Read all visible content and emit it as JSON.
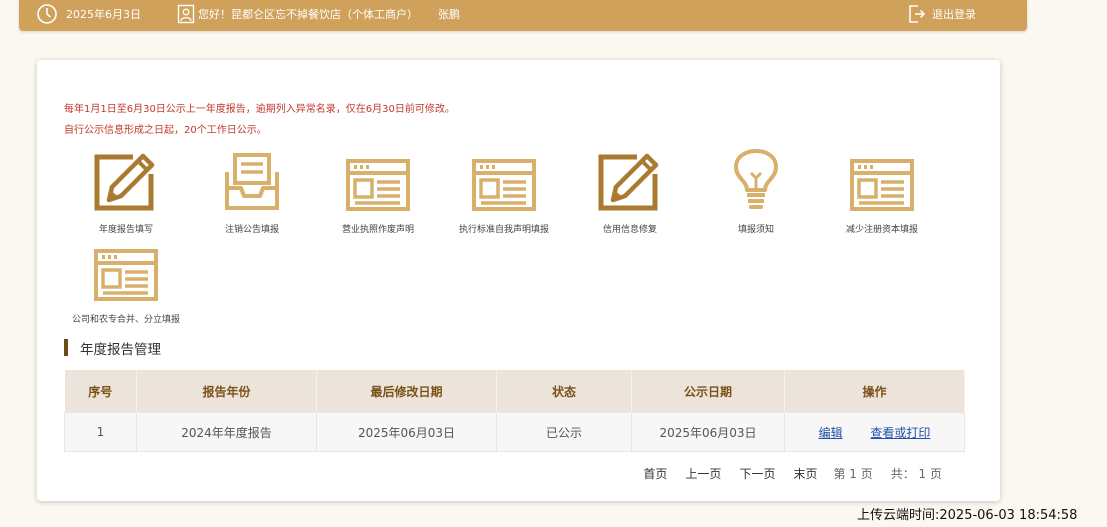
{
  "header": {
    "date": "2025年6月3日",
    "greeting": "您好！昆都仑区忘不掉餐饮店（个体工商户）",
    "user": "张鹏",
    "logout_label": "退出登录"
  },
  "notices": [
    "每年1月1日至6月30日公示上一年度报告，逾期列入异常名录，仅在6月30日前可修改。",
    "自行公示信息形成之日起，20个工作日公示。"
  ],
  "tiles": [
    {
      "label": "年度报告填写",
      "icon": "edit-form-icon"
    },
    {
      "label": "注销公告填报",
      "icon": "inbox-tray-icon"
    },
    {
      "label": "营业执照作废声明",
      "icon": "document-panel-icon"
    },
    {
      "label": "执行标准自我声明填报",
      "icon": "document-panel-icon"
    },
    {
      "label": "信用信息修复",
      "icon": "edit-form-icon"
    },
    {
      "label": "填报须知",
      "icon": "lightbulb-icon"
    },
    {
      "label": "减少注册资本填报",
      "icon": "document-panel-icon"
    },
    {
      "label": "公司和农专合并、分立填报",
      "icon": "document-panel-icon"
    }
  ],
  "section_title": "年度报告管理",
  "table": {
    "headers": [
      "序号",
      "报告年份",
      "最后修改日期",
      "状态",
      "公示日期",
      "操作"
    ],
    "rows": [
      {
        "index": "1",
        "year": "2024年年度报告",
        "modified": "2025年06月03日",
        "status": "已公示",
        "published": "2025年06月03日",
        "edit": "编辑",
        "view": "查看或打印"
      }
    ]
  },
  "pagination": {
    "first": "首页",
    "prev": "上一页",
    "next": "下一页",
    "last": "末页",
    "page_info": "第 1 页",
    "total_info": "共： 1 页"
  },
  "upload_time": "上传云端时间:2025-06-03 18:54:58",
  "colors": {
    "gold": "#cfa15b",
    "icon_dark": "#a97a2f",
    "icon_light": "#d9b06b",
    "notice_red": "#c0392b",
    "header_brown": "#7a5218",
    "link_blue": "#1f4fa8"
  }
}
